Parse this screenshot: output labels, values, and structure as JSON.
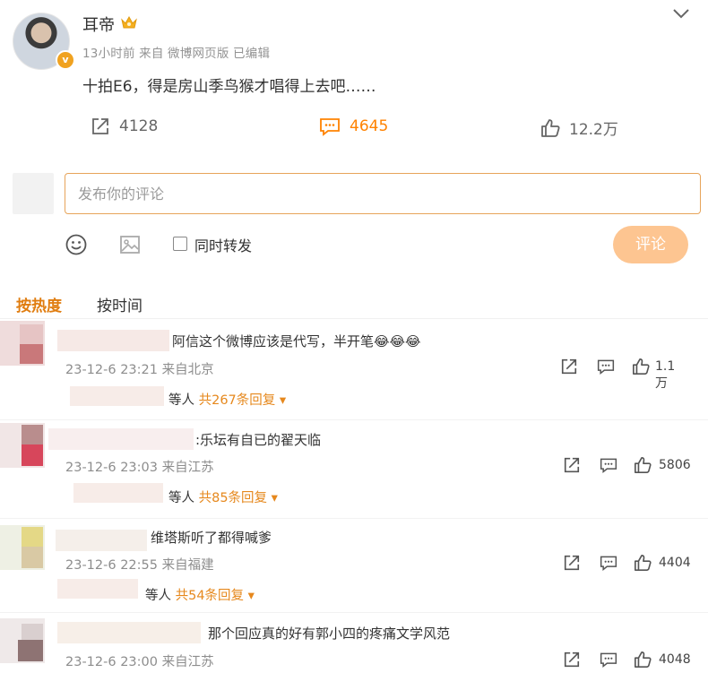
{
  "post": {
    "author": "耳帝",
    "meta": "13小时前  来自 微博网页版  已编辑",
    "text": "十拍E6，得是房山季鸟猴才唱得上去吧……",
    "verified_badge": "v",
    "actions": {
      "share_count": "4128",
      "comment_count": "4645",
      "like_count": "12.2万"
    }
  },
  "composer": {
    "placeholder": "发布你的评论",
    "repost_label": "同时转发",
    "submit_label": "评论"
  },
  "sort_tabs": {
    "hot": "按热度",
    "time": "按时间"
  },
  "comments": [
    {
      "text": "阿信这个微博应该是代写，半开笔😂😂😂",
      "time": "23-12-6 23:21",
      "location": "来自北京",
      "like_count": "1.1万",
      "reply_prefix": "等人",
      "reply_count_label": "共267条回复"
    },
    {
      "text": ":乐坛有自已的翟天临",
      "time": "23-12-6 23:03",
      "location": "来自江苏",
      "like_count": "5806",
      "reply_prefix": "等人",
      "reply_count_label": "共85条回复"
    },
    {
      "text": "维塔斯听了都得喊爹",
      "time": "23-12-6 22:55",
      "location": "来自福建",
      "like_count": "4404",
      "reply_prefix": "等人",
      "reply_count_label": "共54条回复"
    },
    {
      "text": "那个回应真的好有郭小四的疼痛文学风范",
      "time": "23-12-6 23:00",
      "location": "来自江苏",
      "like_count": "4048"
    }
  ],
  "colors": {
    "accent": "#ff8200",
    "submit_bg": "#fdc591",
    "input_border": "#e7a45a"
  }
}
